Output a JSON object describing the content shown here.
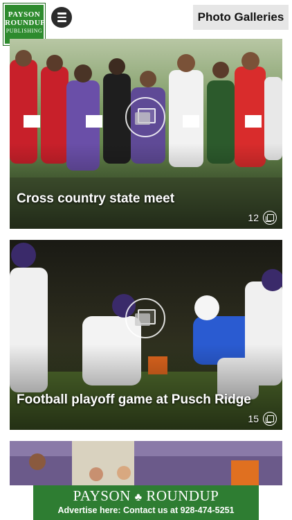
{
  "header": {
    "logo": {
      "line1": "PAYSON",
      "line2": "ROUNDUP",
      "line3": "PUBLISHING"
    },
    "menu_icon": "menu-icon",
    "title": "Photo Galleries"
  },
  "galleries": [
    {
      "caption": "Cross country state meet",
      "count": "12"
    },
    {
      "caption": "Football playoff game at Pusch Ridge",
      "count": "15"
    },
    {
      "caption": "",
      "count": ""
    }
  ],
  "ad": {
    "brand": "PAYSON",
    "brand_mark": "♣",
    "brand2": "ROUNDUP",
    "line": "Advertise here: Contact us at 928-474-5251",
    "color": "#2e7d32"
  },
  "colors": {
    "logo_green": "#2e8b2e",
    "title_bg": "#e6e6e6"
  }
}
